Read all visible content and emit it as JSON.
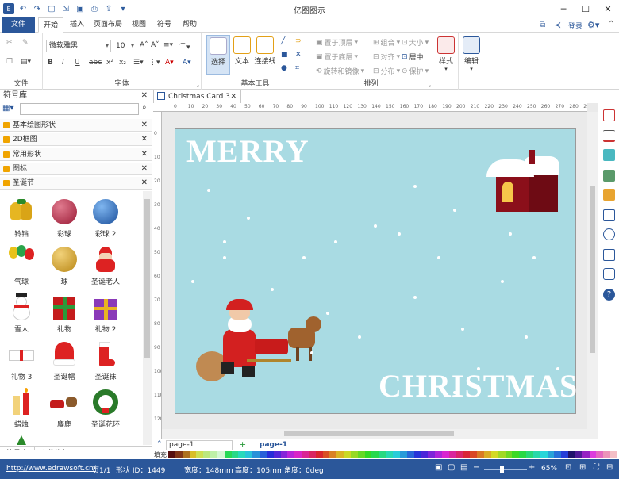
{
  "window": {
    "title": "亿图图示"
  },
  "menu": {
    "file": "文件",
    "tabs": [
      "开始",
      "插入",
      "页面布局",
      "视图",
      "符号",
      "帮助"
    ],
    "login": "登录"
  },
  "ribbon": {
    "groups": {
      "file": "文件",
      "font": "字体",
      "tools": "基本工具",
      "arrange": "排列"
    },
    "font_name": "微软雅黑",
    "font_size": "10",
    "tools": {
      "select": "选择",
      "text": "文本",
      "connector": "连接线"
    },
    "arrange": {
      "bring_front": "置于顶层",
      "send_back": "置于底层",
      "rotate": "旋转和镜像",
      "group": "组合",
      "align": "对齐",
      "distribute": "分布",
      "size": "大小",
      "center": "居中",
      "protect": "保护"
    },
    "style": "样式",
    "edit": "编辑"
  },
  "sidebar": {
    "title": "符号库",
    "sections": [
      "基本绘图形状",
      "2D框图",
      "常用形状",
      "图标",
      "圣诞节"
    ],
    "shapes": [
      "铃铛",
      "彩球",
      "彩球 2",
      "气球",
      "球",
      "圣诞老人",
      "雪人",
      "礼物",
      "礼物 2",
      "礼物 3",
      "圣诞帽",
      "圣诞袜",
      "蜡烛",
      "麋鹿",
      "圣诞花环"
    ],
    "bottom_tabs": [
      "符号库",
      "文件恢复"
    ]
  },
  "document": {
    "tab": "Christmas Card 3",
    "ruler_h": [
      "0",
      "10",
      "20",
      "30",
      "40",
      "50",
      "60",
      "70",
      "80",
      "90",
      "100",
      "110",
      "120",
      "130",
      "140",
      "150",
      "160",
      "170",
      "180",
      "190",
      "200",
      "210",
      "220",
      "230",
      "240",
      "250",
      "260",
      "270",
      "280",
      "290",
      "300"
    ],
    "ruler_v": [
      "0",
      "10",
      "20",
      "30",
      "40",
      "50",
      "60",
      "70",
      "80",
      "90",
      "100",
      "110",
      "120",
      "130"
    ]
  },
  "card": {
    "merry": "MERRY",
    "christmas": "CHRISTMAS",
    "bg": "#a9dbe3"
  },
  "pages": {
    "selector": "page-1",
    "active": "page-1"
  },
  "palette_label": "填充",
  "status": {
    "url": "http://www.edrawsoft.cn/",
    "page": "页1/1",
    "shape_id": "形状 ID：1449",
    "width": "宽度：148mm",
    "height": "高度：105mm",
    "angle": "角度：0deg",
    "zoom": "65%"
  },
  "colors": {
    "accent": "#2b579a",
    "folder": "#f0a400"
  }
}
